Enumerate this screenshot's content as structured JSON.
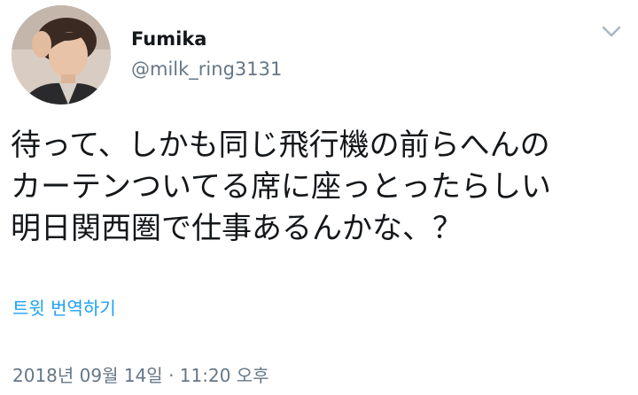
{
  "tweet": {
    "display_name": "Fumika",
    "handle": "@milk_ring3131",
    "text_lines": [
      "待って、しかも同じ飛行機の前らへんの",
      "カーテンついてる席に座っとったらしい",
      "明日関西圏で仕事あるんかな、？"
    ],
    "translate_label": "트윗 번역하기",
    "timestamp": "2018년 09월 14일 · 11:20 오후"
  },
  "icons": {
    "menu": "chevron-down-icon",
    "avatar": "profile-photo"
  },
  "colors": {
    "text": "#14171a",
    "secondary": "#657786",
    "link": "#1da1f2",
    "caret": "#aab8c2"
  }
}
